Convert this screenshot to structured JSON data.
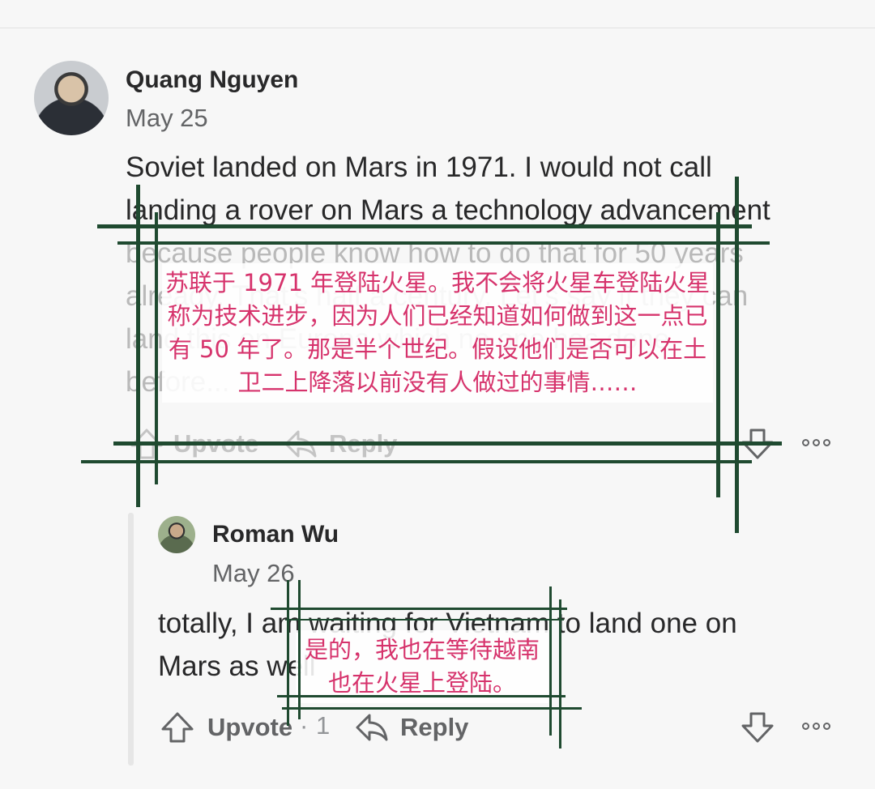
{
  "comment": {
    "author": "Quang Nguyen",
    "date": "May 25",
    "text_lines": [
      "Soviet landed on Mars in 1971. I would not call",
      "landing a rover on Mars a technology advancement",
      "because people know how to do that for 50 years",
      "already. That's half a century. Let's say if they can",
      "land this on Europa which no one has done",
      "before..."
    ],
    "upvote_label": "Upvote",
    "reply_label": "Reply",
    "translation": "苏联于 1971 年登陆火星。我不会将火星车登陆火星称为技术进步，因为人们已经知道如何做到这一点已有 50 年了。那是半个世纪。假设他们是否可以在土卫二上降落以前没有人做过的事情……"
  },
  "reply": {
    "author": "Roman Wu",
    "date": "May 26",
    "text_lines": [
      "totally, I am waiting for Vietnam to land one on",
      "Mars as well"
    ],
    "upvote_label": "Upvote",
    "upvote_separator": "·",
    "upvote_count": "1",
    "reply_label": "Reply",
    "translation": "是的，我也在等待越南也在火星上登陆。"
  },
  "icons": [
    "upvote-arrow-icon",
    "reply-arrow-icon",
    "downvote-arrow-icon",
    "more-options-icon"
  ],
  "colors": {
    "overlay_text": "#d6336c",
    "frame_lines": "#1f4a30"
  }
}
